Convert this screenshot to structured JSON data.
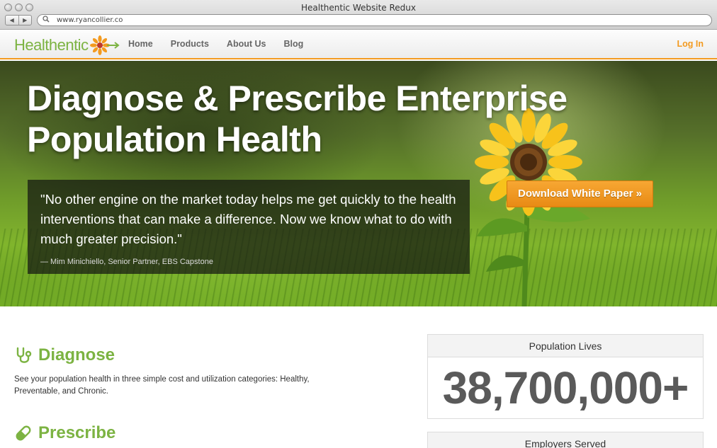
{
  "browser": {
    "window_title": "Healthentic Website Redux",
    "url": "www.ryancollier.co",
    "back_glyph": "◀",
    "forward_glyph": "▶",
    "url_icon": "search-icon"
  },
  "site": {
    "logo_text": "Healthentic",
    "nav": [
      "Home",
      "Products",
      "About Us",
      "Blog"
    ],
    "login_label": "Log In",
    "accent_color": "#f39a1f",
    "brand_green": "#7cb342"
  },
  "hero": {
    "headline_line1": "Diagnose & Prescribe Enterprise",
    "headline_line2": "Population Health",
    "quote": "\"No other engine on the market today helps me get quickly to the health interventions that can make a difference. Now we know what to do with much greater precision.\"",
    "citation": "— Mim Minichiello, Senior Partner, EBS Capstone",
    "cta_label": "Download White Paper »"
  },
  "sections": {
    "diagnose": {
      "title": "Diagnose",
      "icon": "stethoscope-icon",
      "body": "See your population health in three simple cost and utilization categories: Healthy, Preventable, and Chronic."
    },
    "prescribe": {
      "title": "Prescribe",
      "icon": "pill-icon"
    }
  },
  "stats": {
    "population_label": "Population Lives",
    "population_value": "38,700,000+",
    "employers_label": "Employers Served"
  }
}
